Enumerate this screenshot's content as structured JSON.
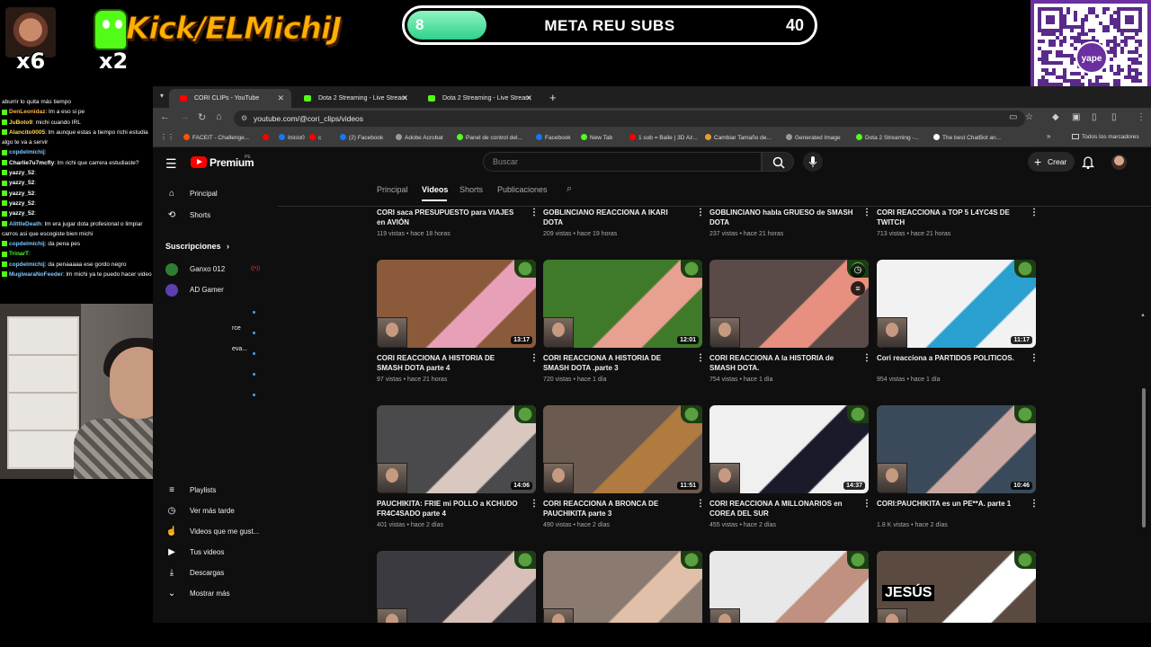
{
  "overlay": {
    "emote1_count": "x6",
    "emote2_count": "x2",
    "kick_handle": "Kick/ELMichiJ",
    "goal": {
      "current": "8",
      "title": "META REU SUBS",
      "target": "40",
      "progress": 0.2
    },
    "qr_label": "yape"
  },
  "chat": [
    {
      "user": "",
      "msg": "aburrir lo quita más tiempo",
      "color": "#ffffff"
    },
    {
      "user": "DenLeonidaz",
      "msg": ": lm a eso si pe",
      "color": "#ffb347"
    },
    {
      "user": "JuBoto9",
      "msg": ": michi cuando IRL",
      "color": "#ffd54f"
    },
    {
      "user": "Alancito0005",
      "msg": ": lm aunque estas a tiempo richi estudia algo te va a servir",
      "color": "#ffd54f"
    },
    {
      "user": "copdelmichij",
      "msg": ":",
      "color": "#7ec8ff"
    },
    {
      "user": "Charlie7u7mcfly",
      "msg": ": lm richi que carrera estudiaste?",
      "color": "#ffffff"
    },
    {
      "user": "yazzy_52",
      "msg": ":",
      "color": "#ffffff"
    },
    {
      "user": "yazzy_52",
      "msg": ":",
      "color": "#ffffff"
    },
    {
      "user": "yazzy_52",
      "msg": ":",
      "color": "#ffffff"
    },
    {
      "user": "yazzy_52",
      "msg": ":",
      "color": "#ffffff"
    },
    {
      "user": "yazzy_52",
      "msg": ":",
      "color": "#ffffff"
    },
    {
      "user": "AlittleDeath",
      "msg": ": lm era jugar dota profesional o limpiar carros asi que escogiste bien michi",
      "color": "#7ec8ff"
    },
    {
      "user": "copdelmichij",
      "msg": ": da pena pes",
      "color": "#7ec8ff"
    },
    {
      "user": "TrinarT",
      "msg": ":",
      "color": "#53fc18"
    },
    {
      "user": "copdelmichij",
      "msg": ": da penaaaaa ese gordo negro",
      "color": "#7ec8ff"
    },
    {
      "user": "MugiwaraNoFeeder",
      "msg": ": lm michi ya te puedo hacer video xd",
      "color": "#7ec8ff"
    }
  ],
  "browser": {
    "tabs": [
      {
        "title": "CORI CLIPs - YouTube",
        "icon_color": "#ff0000"
      },
      {
        "title": "Dota 2 Streaming - Live Stream",
        "icon_color": "#53fc18"
      },
      {
        "title": "Dota 2 Streaming - Live Stream",
        "icon_color": "#53fc18"
      }
    ],
    "url": "youtube.com/@cori_clips/videos",
    "bookmarks": [
      {
        "label": "FACEIT - Challenge...",
        "color": "#ff5500"
      },
      {
        "label": "",
        "color": "#ff0000"
      },
      {
        "label": "Inicio0",
        "color": "#1877f2"
      },
      {
        "label": "c",
        "color": "#ff0000"
      },
      {
        "label": "(2) Facebook",
        "color": "#1877f2"
      },
      {
        "label": "Adobe Acrobat",
        "color": "#999999"
      },
      {
        "label": "Panel de control del...",
        "color": "#53fc18"
      },
      {
        "label": "Facebook",
        "color": "#1877f2"
      },
      {
        "label": "New Tab",
        "color": "#53fc18"
      },
      {
        "label": "1 sub = Baile | 3D Az...",
        "color": "#ff0000"
      },
      {
        "label": "Cambiar Tamaño de...",
        "color": "#e0a030"
      },
      {
        "label": "Generated Image",
        "color": "#999999"
      },
      {
        "label": "Dota 2 Streaming -...",
        "color": "#53fc18"
      },
      {
        "label": "The best ChatBot an...",
        "color": "#ffffff"
      }
    ],
    "all_bookmarks": "Todos los marcadores"
  },
  "youtube": {
    "brand": "Premium",
    "brand_sup": "PE",
    "search_placeholder": "Buscar",
    "create_label": "Crear",
    "sidebar": {
      "home": "Principal",
      "shorts": "Shorts",
      "subs_title": "Suscripciones",
      "subs": [
        {
          "name": "Ganxo 012",
          "color": "#2e7d32"
        },
        {
          "name": "AD Gamer",
          "color": "#5c3fb0"
        }
      ],
      "trunc1": "rce",
      "trunc2": "eva...",
      "you_items": [
        "Playlists",
        "Ver más tarde",
        "Videos que me gust...",
        "Tus videos",
        "Descargas",
        "Mostrar más"
      ]
    },
    "channel_tabs": [
      "Principal",
      "Videos",
      "Shorts",
      "Publicaciones"
    ],
    "active_tab": "Videos",
    "rows": [
      [
        {
          "title": "CORI saca PRESUPUESTO para VIAJES en AVIÓN",
          "meta": "119 vistas • hace 18 horas"
        },
        {
          "title": "GOBLINCIANO REACCIONA A IKARI DOTA",
          "meta": "209 vistas • hace 19 horas"
        },
        {
          "title": "GOBLINCIANO habla GRUESO de SMASH DOTA",
          "meta": "237 vistas • hace 21 horas"
        },
        {
          "title": "CORI REACCIONA a TOP 5 L4YC4S DE TWITCH",
          "meta": "713 vistas • hace 21 horas"
        }
      ],
      [
        {
          "title": "CORI REACCIONA A HISTORIA DE SMASH DOTA parte 4",
          "meta": "97 vistas • hace 21 horas",
          "duration": "13:17",
          "bg": "#8a5a3a",
          "accent": "#e8a0b8"
        },
        {
          "title": "CORI REACCIONA A HISTORIA DE SMASH DOTA .parte 3",
          "meta": "720 vistas • hace 1 día",
          "duration": "12:01",
          "bg": "#3f7a2a",
          "accent": "#e8a090"
        },
        {
          "title": "CORI REACCIONA A la HISTORIA de SMASH DOTA.",
          "meta": "754 vistas • hace 1 día",
          "duration": "",
          "bg": "#5a4a48",
          "accent": "#e89080"
        },
        {
          "title": "Cori reacciona a PARTIDOS POLITICOS.",
          "meta": "954 vistas • hace 1 día",
          "duration": "11:17",
          "bg": "#f2f2f2",
          "accent": "#2aa0d0"
        }
      ],
      [
        {
          "title": "PAUCHIKITA: FRIE mi POLLO a KCHUDO FR4C4SADO parte 4",
          "meta": "401 vistas • hace 2 días",
          "duration": "14:06",
          "bg": "#4a4a4c",
          "accent": "#d8c8c0"
        },
        {
          "title": "CORI REACCIONA A BRONCA DE PAUCHIKITA parte 3",
          "meta": "490 vistas • hace 2 días",
          "duration": "11:51",
          "bg": "#6a5a50",
          "accent": "#b07a40"
        },
        {
          "title": "CORI REACCIONA A MILLONARIOS en COREA DEL SUR",
          "meta": "455 vistas • hace 2 días",
          "duration": "14:37",
          "bg": "#f0f0f0",
          "accent": "#1a1a2a"
        },
        {
          "title": "CORI:PAUCHIKITA es un PE**A. parte 1",
          "meta": "1.8 K vistas • hace 2 días",
          "duration": "10:46",
          "bg": "#3a4a5a",
          "accent": "#c8a8a0"
        }
      ],
      [
        {
          "bg": "#3a3a40",
          "accent": "#d8c0b8"
        },
        {
          "bg": "#8a7a70",
          "accent": "#e0c0a8"
        },
        {
          "bg": "#e8e8e8",
          "accent": "#c09080"
        },
        {
          "bg": "#5a4a40",
          "accent": "#ffffff",
          "overlay_text": "JESÚS"
        }
      ]
    ]
  }
}
